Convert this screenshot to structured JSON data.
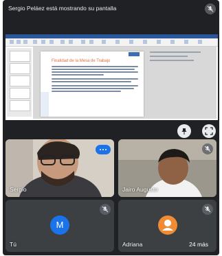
{
  "banner": {
    "text": "Sergio Peláez está mostrando su pantalla"
  },
  "slide": {
    "title": "Finalidad de la Mesa de Trabajo"
  },
  "participants": [
    {
      "name": "Sergio",
      "muted": false,
      "speaking": true
    },
    {
      "name": "Jairo Augusto",
      "muted": true
    },
    {
      "name": "Tú",
      "initial": "M",
      "avatar_color": "#1a73e8",
      "muted": true
    },
    {
      "name": "Adriana",
      "avatar_color": "#f28b35",
      "muted": true
    }
  ],
  "more": {
    "label": "24 más"
  },
  "colors": {
    "background": "#202124",
    "tile": "#3c4043",
    "accent": "#1a73e8"
  }
}
